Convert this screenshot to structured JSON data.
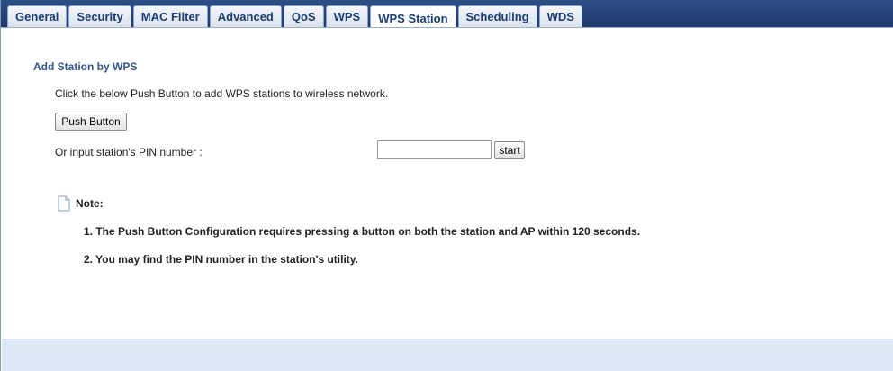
{
  "tabs": [
    {
      "label": "General"
    },
    {
      "label": "Security"
    },
    {
      "label": "MAC Filter"
    },
    {
      "label": "Advanced"
    },
    {
      "label": "QoS"
    },
    {
      "label": "WPS"
    },
    {
      "label": "WPS Station",
      "active": true
    },
    {
      "label": "Scheduling"
    },
    {
      "label": "WDS"
    }
  ],
  "section": {
    "title": "Add Station by WPS",
    "description": "Click the below Push Button to add WPS stations to wireless network.",
    "push_button_label": "Push Button",
    "pin_label": "Or input station's PIN number :",
    "pin_value": "",
    "start_label": "start"
  },
  "note": {
    "title": "Note:",
    "icon": "document-icon",
    "items": [
      "1. The Push Button Configuration requires pressing a button on both the station and AP within 120 seconds.",
      "2. You may find the PIN number in the station's utility."
    ]
  },
  "colors": {
    "tabbar": "#1f3a6b",
    "tab_text": "#1a3c73",
    "section_title": "#34568b",
    "footer": "#dfe9f5"
  }
}
